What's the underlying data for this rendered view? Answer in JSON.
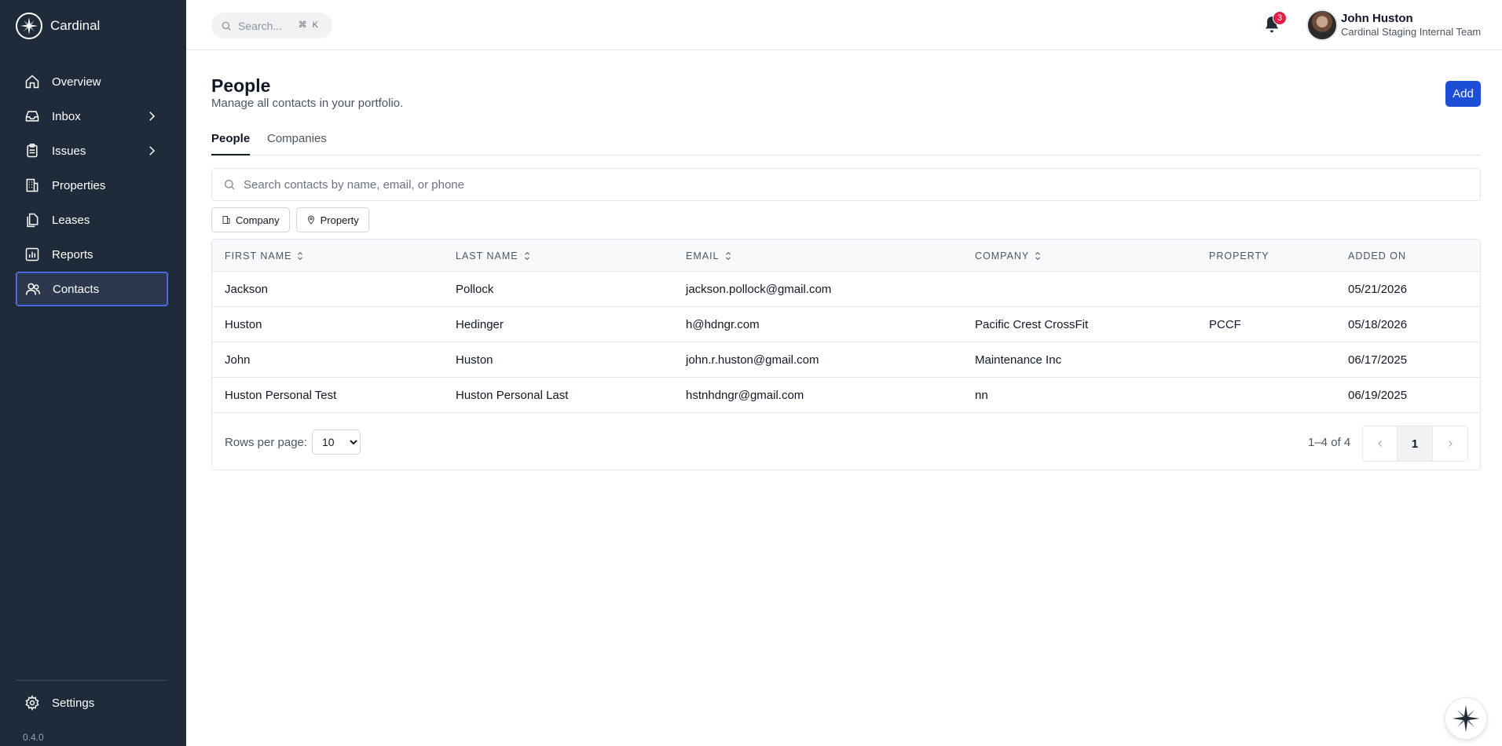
{
  "brand": {
    "name": "Cardinal"
  },
  "sidebar": {
    "items": [
      {
        "label": "Overview",
        "icon": "home-icon"
      },
      {
        "label": "Inbox",
        "icon": "inbox-icon",
        "expandable": true
      },
      {
        "label": "Issues",
        "icon": "clipboard-icon",
        "expandable": true
      },
      {
        "label": "Properties",
        "icon": "building-icon"
      },
      {
        "label": "Leases",
        "icon": "documents-icon"
      },
      {
        "label": "Reports",
        "icon": "chart-icon"
      },
      {
        "label": "Contacts",
        "icon": "users-icon",
        "active": true
      }
    ],
    "settings_label": "Settings",
    "version": "0.4.0"
  },
  "header": {
    "search_placeholder": "Search...",
    "shortcut": "⌘ K",
    "notification_count": "3",
    "user_name": "John Huston",
    "user_team": "Cardinal Staging Internal Team"
  },
  "page": {
    "title": "People",
    "subtitle": "Manage all contacts in your portfolio.",
    "add_label": "Add",
    "tabs": [
      {
        "label": "People",
        "active": true
      },
      {
        "label": "Companies",
        "active": false
      }
    ],
    "search_placeholder": "Search contacts by name, email, or phone",
    "filters": [
      {
        "label": "Company",
        "icon": "building-icon"
      },
      {
        "label": "Property",
        "icon": "map-pin-icon"
      }
    ]
  },
  "table": {
    "columns": [
      "FIRST NAME",
      "LAST NAME",
      "EMAIL",
      "COMPANY",
      "PROPERTY",
      "ADDED ON"
    ],
    "rows": [
      {
        "first": "Jackson",
        "last": "Pollock",
        "email": "jackson.pollock@gmail.com",
        "company": "",
        "property": "",
        "added": "05/21/2026"
      },
      {
        "first": "Huston",
        "last": "Hedinger",
        "email": "h@hdngr.com",
        "company": "Pacific Crest CrossFit",
        "property": "PCCF",
        "added": "05/18/2026"
      },
      {
        "first": "John",
        "last": "Huston",
        "email": "john.r.huston@gmail.com",
        "company": "Maintenance Inc",
        "property": "",
        "added": "06/17/2025"
      },
      {
        "first": "Huston Personal Test",
        "last": "Huston Personal Last",
        "email": "hstnhdngr@gmail.com",
        "company": "nn",
        "property": "",
        "added": "06/19/2025"
      }
    ],
    "rows_per_page_label": "Rows per page:",
    "rows_per_page": "10",
    "range": "1–4 of 4",
    "current_page": "1"
  },
  "colors": {
    "sidebar_bg": "#1f2a3b",
    "accent": "#1d4ed8",
    "badge": "#e11d48"
  }
}
